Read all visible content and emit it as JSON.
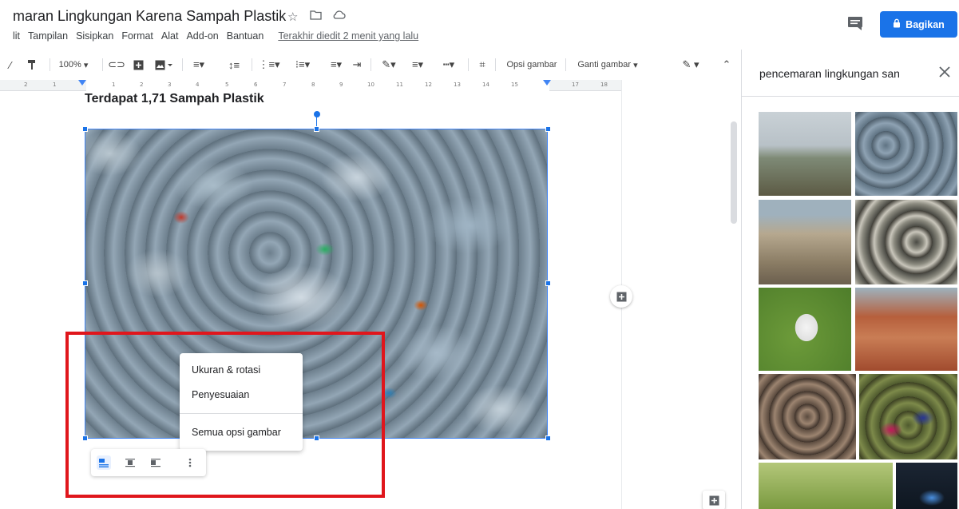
{
  "doc": {
    "title": "maran Lingkungan Karena Sampah Plastik",
    "last_edit": "Terakhir diedit 2 menit yang lalu",
    "heading": "Terdapat 1,71 Sampah Plastik"
  },
  "menu": [
    "lit",
    "Tampilan",
    "Sisipkan",
    "Format",
    "Alat",
    "Add-on",
    "Bantuan"
  ],
  "share": {
    "label": "Bagikan"
  },
  "toolbar": {
    "zoom": "100%",
    "image_options": "Opsi gambar",
    "replace_image": "Ganti gambar"
  },
  "ruler": {
    "numbers": [
      "2",
      "1",
      "1",
      "2",
      "3",
      "4",
      "5",
      "6",
      "7",
      "8",
      "9",
      "10",
      "11",
      "12",
      "13",
      "14",
      "15",
      "17",
      "18"
    ]
  },
  "context_menu": {
    "item_size": "Ukuran & rotasi",
    "item_adjust": "Penyesuaian",
    "item_all": "Semua opsi gambar"
  },
  "explore": {
    "query": "pencemaran lingkungan san"
  },
  "icons": [
    "star-icon",
    "folder-icon",
    "cloud-icon",
    "comment-icon",
    "lock-icon",
    "close-icon",
    "add-comment-icon",
    "explore-icon",
    "more-vert-icon"
  ],
  "colors": {
    "share_button": "#1a73e8",
    "selection": "#1a73e8",
    "highlight": "#e0161c"
  }
}
